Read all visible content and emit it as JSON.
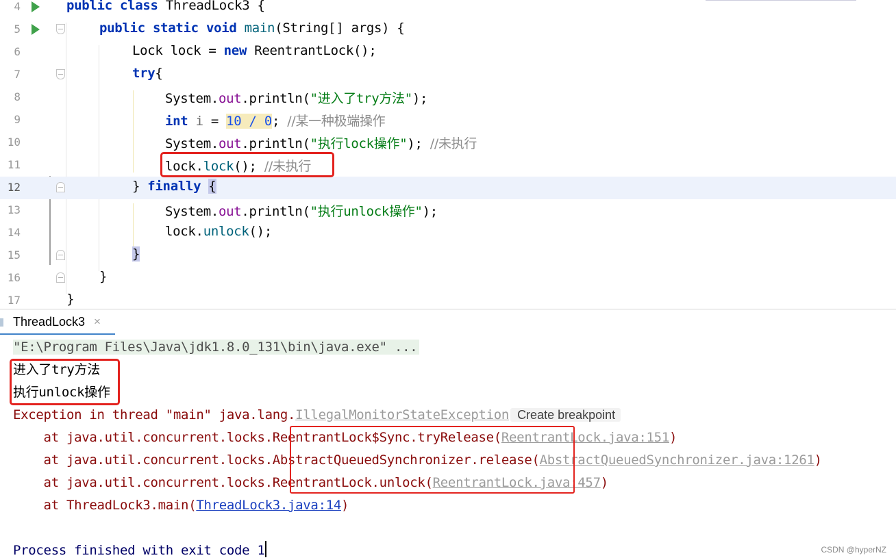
{
  "editor": {
    "lines": [
      {
        "n": "4"
      },
      {
        "n": "5"
      },
      {
        "n": "6"
      },
      {
        "n": "7"
      },
      {
        "n": "8"
      },
      {
        "n": "9"
      },
      {
        "n": "10"
      },
      {
        "n": "11"
      },
      {
        "n": "12"
      },
      {
        "n": "13"
      },
      {
        "n": "14"
      },
      {
        "n": "15"
      },
      {
        "n": "16"
      },
      {
        "n": "17"
      }
    ],
    "code": {
      "l4_kw": "public class ",
      "l4_rest": "ThreadLock3 {",
      "l5_kw": "public static void ",
      "l5_mth": "main",
      "l5_rest": "(String[] args) {",
      "l6_a": "Lock lock = ",
      "l6_kw": "new ",
      "l6_b": "ReentrantLock();",
      "l7_kw": "try",
      "l7_b": "{",
      "l8_a": "System.",
      "l8_fld": "out",
      "l8_b": ".println(",
      "l8_q1": "\"",
      "l8_cjk1": "进入了",
      "l8_s": "try",
      "l8_cjk2": "方法",
      "l8_q2": "\"",
      "l8_c": ");",
      "l9_kw": "int ",
      "l9_var": "i",
      "l9_a": " = ",
      "l9_warn": "10 / 0",
      "l9_b": "; ",
      "l9_cmt": "//某一种极端操作",
      "l10_a": "System.",
      "l10_fld": "out",
      "l10_b": ".println(",
      "l10_q1": "\"",
      "l10_cjk1": "执行",
      "l10_s": "lock",
      "l10_cjk2": "操作",
      "l10_q2": "\"",
      "l10_c": "); ",
      "l10_cmt": "//未执行",
      "l11_a": "lock.",
      "l11_mth": "lock",
      "l11_b": "(); ",
      "l11_cmt": "//未执行",
      "l12_a": "} ",
      "l12_kw": "finally ",
      "l12_b": "{",
      "l13_a": "System.",
      "l13_fld": "out",
      "l13_b": ".println(",
      "l13_q1": "\"",
      "l13_cjk1": "执行",
      "l13_s": "unlock",
      "l13_cjk2": "操作",
      "l13_q2": "\"",
      "l13_c": ");",
      "l14_a": "lock.",
      "l14_mth": "unlock",
      "l14_b": "();",
      "l15_a": "}",
      "l16_a": "}",
      "l17_a": "}"
    }
  },
  "console": {
    "tab_label": "ThreadLock3",
    "tab_close": "×",
    "cmd": "\"E:\\Program Files\\Java\\jdk1.8.0_131\\bin\\java.exe\" ...",
    "out1_cjk1": "进入了",
    "out1_en": "try",
    "out1_cjk2": "方法",
    "out2_cjk1": "执行",
    "out2_en": "unlock",
    "out2_cjk2": "操作",
    "exc_prefix": "Exception in thread \"main\" java.lang.",
    "exc_link": "IllegalMonitorStateException",
    "exc_hint": "Create breakpoint",
    "st1_a": "    at java.util.concurrent.locks.",
    "st1_b": "ReentrantLock$Sync.tryRelease(",
    "st1_link": "ReentrantLock.java:151",
    "st1_c": ")",
    "st2_a": "    at java.util.concurrent.locks.",
    "st2_b": "AbstractQueuedSynchronizer.release(",
    "st2_link": "AbstractQueuedSynchronizer.java:1261",
    "st2_c": ")",
    "st3_a": "    at java.util.concurrent.locks.",
    "st3_b": "ReentrantLock.unlock(",
    "st3_link": "ReentrantLock.java:457",
    "st3_c": ")",
    "st4_a": "    at ThreadLock3.main(",
    "st4_link": "ThreadLock3.java:14",
    "st4_c": ")",
    "exit": "Process finished with exit code 1"
  },
  "watermark": "CSDN @hyperNZ"
}
